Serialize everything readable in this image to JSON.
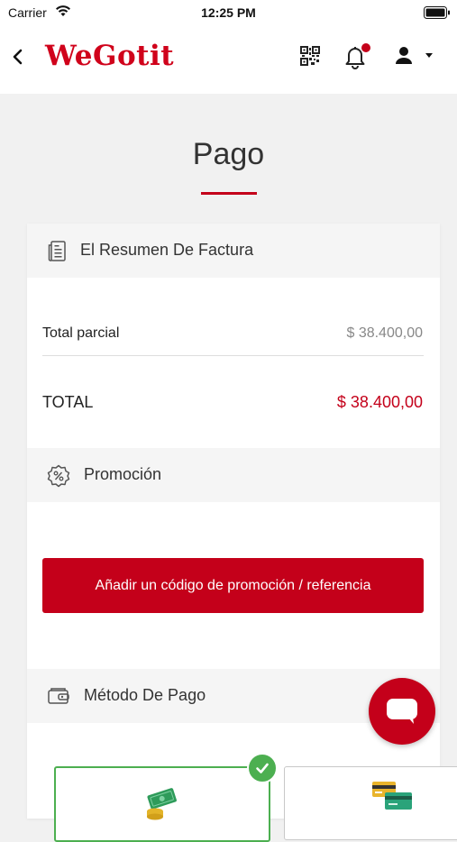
{
  "status_bar": {
    "carrier": "Carrier",
    "time": "12:25 PM"
  },
  "header": {
    "brand": "WeGotit",
    "has_notification": true
  },
  "page": {
    "title": "Pago"
  },
  "invoice_summary": {
    "heading": "El Resumen De Factura",
    "subtotal_label": "Total parcial",
    "subtotal_value": "$ 38.400,00",
    "total_label": "TOTAL",
    "total_value": "$ 38.400,00"
  },
  "promotion": {
    "heading": "Promoción",
    "button_label": "Añadir un código de promoción / referencia"
  },
  "payment_method": {
    "heading": "Método De Pago",
    "options": [
      {
        "icon": "cash-icon",
        "selected": true
      },
      {
        "icon": "credit-card-icon",
        "selected": false
      }
    ]
  },
  "colors": {
    "brand": "#d0021b",
    "accent": "#c4001a",
    "selected": "#4caf50"
  }
}
